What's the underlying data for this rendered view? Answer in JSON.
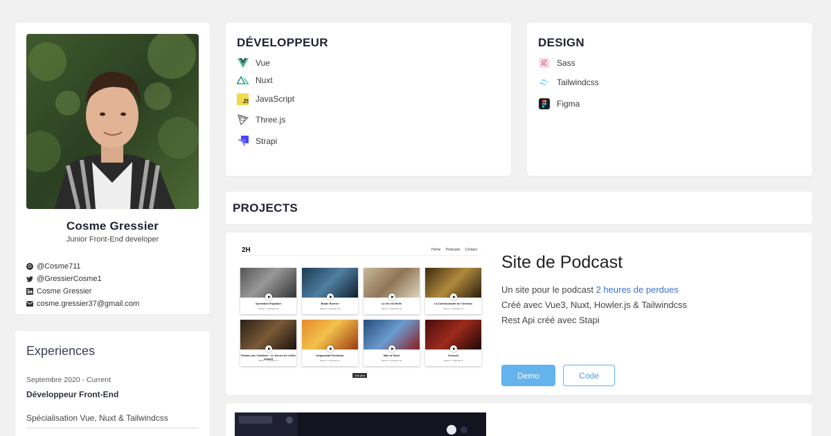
{
  "profile": {
    "name": "Cosme Gressier",
    "role": "Junior Front-End developer",
    "contacts": [
      {
        "icon": "github-icon",
        "text": "@Cosme711"
      },
      {
        "icon": "twitter-icon",
        "text": "@GressierCosme1"
      },
      {
        "icon": "linkedin-icon",
        "text": "Cosme Gressier"
      },
      {
        "icon": "mail-icon",
        "text": "cosme.gressier37@gmail.com"
      }
    ]
  },
  "experiences": {
    "title": "Experiences",
    "date": "Septembre 2020 - Current",
    "role": "Développeur Front-End",
    "description": "Spécialisation Vue, Nuxt & Tailwindcss"
  },
  "developer": {
    "title": "DÉVELOPPEUR",
    "skills": [
      {
        "label": "Vue",
        "icon": "vue-icon",
        "color": "#41b883"
      },
      {
        "label": "Nuxt",
        "icon": "nuxt-icon",
        "color": "#00c58e"
      },
      {
        "label": "JavaScript",
        "icon": "javascript-icon",
        "color": "#f0db4f"
      },
      {
        "label": "Three.js",
        "icon": "threejs-icon",
        "color": "#555555"
      },
      {
        "label": "Strapi",
        "icon": "strapi-icon",
        "color": "#4945ff"
      }
    ]
  },
  "design": {
    "title": "DESIGN",
    "skills": [
      {
        "label": "Sass",
        "icon": "sass-icon",
        "color": "#cd6799"
      },
      {
        "label": "Tailwindcss",
        "icon": "tailwindcss-icon",
        "color": "#38bdf8"
      },
      {
        "label": "Figma",
        "icon": "figma-icon",
        "color": "#1e1e1e"
      }
    ]
  },
  "projects": {
    "title": "PROJECTS",
    "items": [
      {
        "name": "Site de Podcast",
        "desc_prefix": "Un site pour le podcast ",
        "desc_link": "2 heures de perdues",
        "desc_line2": "Créé avec Vue3, Nuxt, Howler.js & Tailwindcss",
        "desc_line3": "Rest Api créé avec Stapi",
        "demo_label": "Demo",
        "code_label": "Code",
        "screenshot": {
          "logo": "2H",
          "nav": [
            "Home",
            "Podcasts",
            "Contact"
          ],
          "more": "Voir plus",
          "episodes": [
            {
              "title": "Opération Espadon",
              "meta": "Saison 7 | Episode 16"
            },
            {
              "title": "Blade Runner",
              "meta": "Saison 7 | Episode 15"
            },
            {
              "title": "La Vie est Belle",
              "meta": "Saison 7 | Episode 14"
            },
            {
              "title": "La Communauté de l'Anneau",
              "meta": "Saison 7 | Episode 13"
            },
            {
              "title": "Pirates des Caraïbes : Le Secret du coffre maudit",
              "meta": "Saison 7 | Episode 12"
            },
            {
              "title": "Dragonball Evolution",
              "meta": "Saison 7 | Episode 11"
            },
            {
              "title": "Man of Steel",
              "meta": "Saison 7 | Episode 10"
            },
            {
              "title": "Dracula",
              "meta": "Saison 7 | Episode 9"
            }
          ]
        }
      }
    ]
  }
}
